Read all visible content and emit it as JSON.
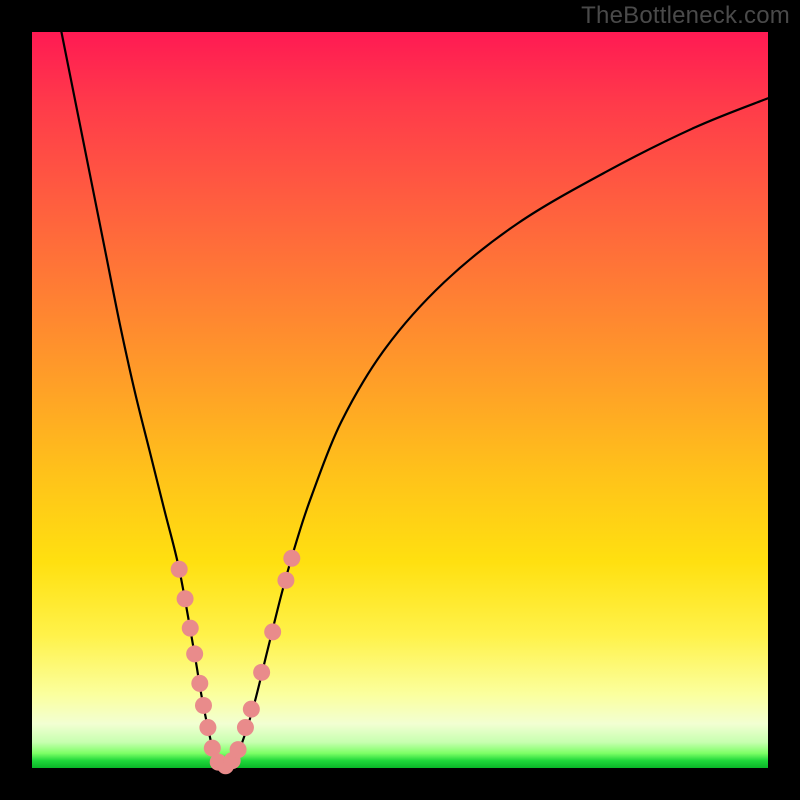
{
  "watermark": "TheBottleneck.com",
  "chart_data": {
    "type": "line",
    "title": "",
    "xlabel": "",
    "ylabel": "",
    "xlim": [
      0,
      100
    ],
    "ylim": [
      0,
      100
    ],
    "series": [
      {
        "name": "curve",
        "x": [
          4,
          6,
          8,
          10,
          12,
          14,
          16,
          18,
          20,
          22,
          23,
          24,
          25,
          26,
          27,
          28,
          30,
          32,
          34,
          36,
          38,
          42,
          48,
          56,
          66,
          78,
          90,
          100
        ],
        "y": [
          100,
          90,
          80,
          70,
          60,
          51,
          43,
          35,
          27,
          16,
          10,
          5,
          1,
          0,
          0.5,
          2,
          8,
          16,
          24,
          31,
          37,
          47,
          57,
          66,
          74,
          81,
          87,
          91
        ]
      }
    ],
    "markers": {
      "name": "dots",
      "color": "#e98b8b",
      "points": [
        {
          "x": 20.0,
          "y": 27
        },
        {
          "x": 20.8,
          "y": 23
        },
        {
          "x": 21.5,
          "y": 19
        },
        {
          "x": 22.1,
          "y": 15.5
        },
        {
          "x": 22.8,
          "y": 11.5
        },
        {
          "x": 23.3,
          "y": 8.5
        },
        {
          "x": 23.9,
          "y": 5.5
        },
        {
          "x": 24.5,
          "y": 2.7
        },
        {
          "x": 25.3,
          "y": 0.8
        },
        {
          "x": 26.3,
          "y": 0.3
        },
        {
          "x": 27.2,
          "y": 1.0
        },
        {
          "x": 28.0,
          "y": 2.5
        },
        {
          "x": 29.0,
          "y": 5.5
        },
        {
          "x": 29.8,
          "y": 8.0
        },
        {
          "x": 31.2,
          "y": 13.0
        },
        {
          "x": 32.7,
          "y": 18.5
        },
        {
          "x": 34.5,
          "y": 25.5
        },
        {
          "x": 35.3,
          "y": 28.5
        }
      ]
    }
  }
}
